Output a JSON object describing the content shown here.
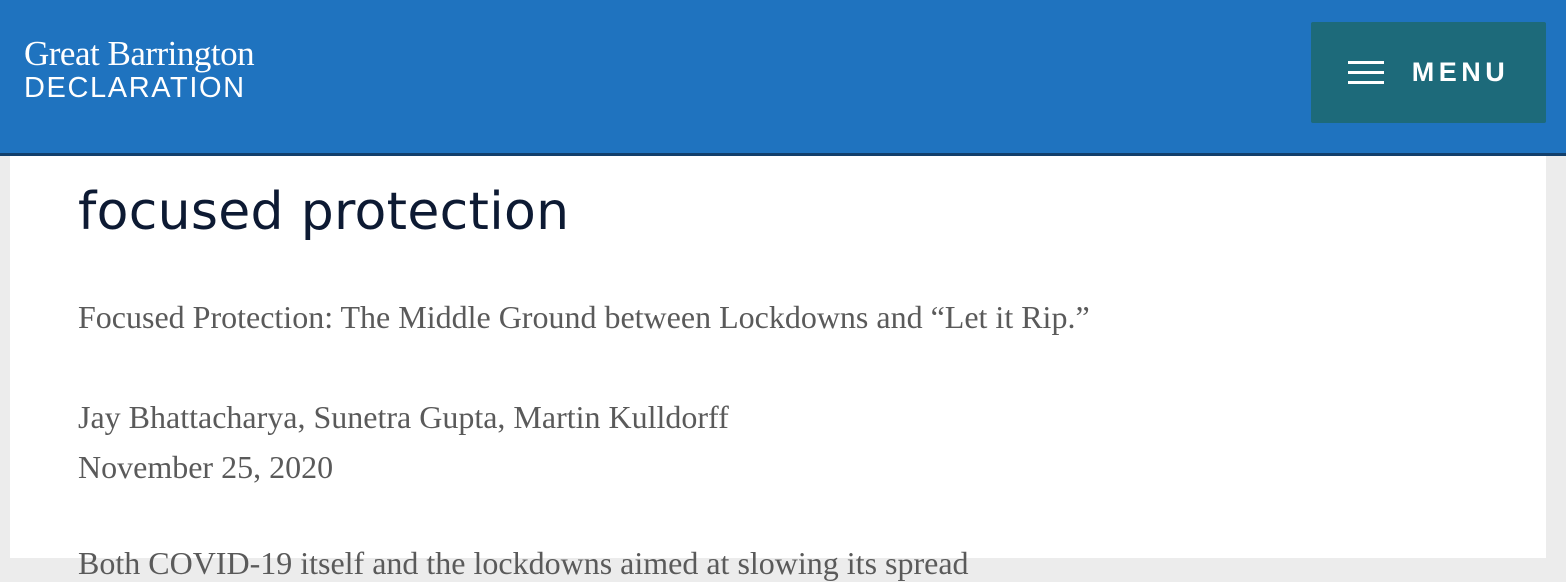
{
  "header": {
    "logo_line1": "Great Barrington",
    "logo_line2": "DECLARATION",
    "menu_label": "MENU",
    "menu_icon": "hamburger-icon",
    "background_color": "#1f73bf",
    "menu_button_color": "#1d6a7a"
  },
  "article": {
    "title": "focused protection",
    "subtitle": "Focused Protection: The Middle Ground between Lockdowns and “Let it Rip.”",
    "authors": "Jay Bhattacharya, Sunetra Gupta, Martin Kulldorff",
    "date": "November 25, 2020",
    "truncated_text": "Both COVID-19 itself and the lockdowns aimed at slowing its spread"
  }
}
